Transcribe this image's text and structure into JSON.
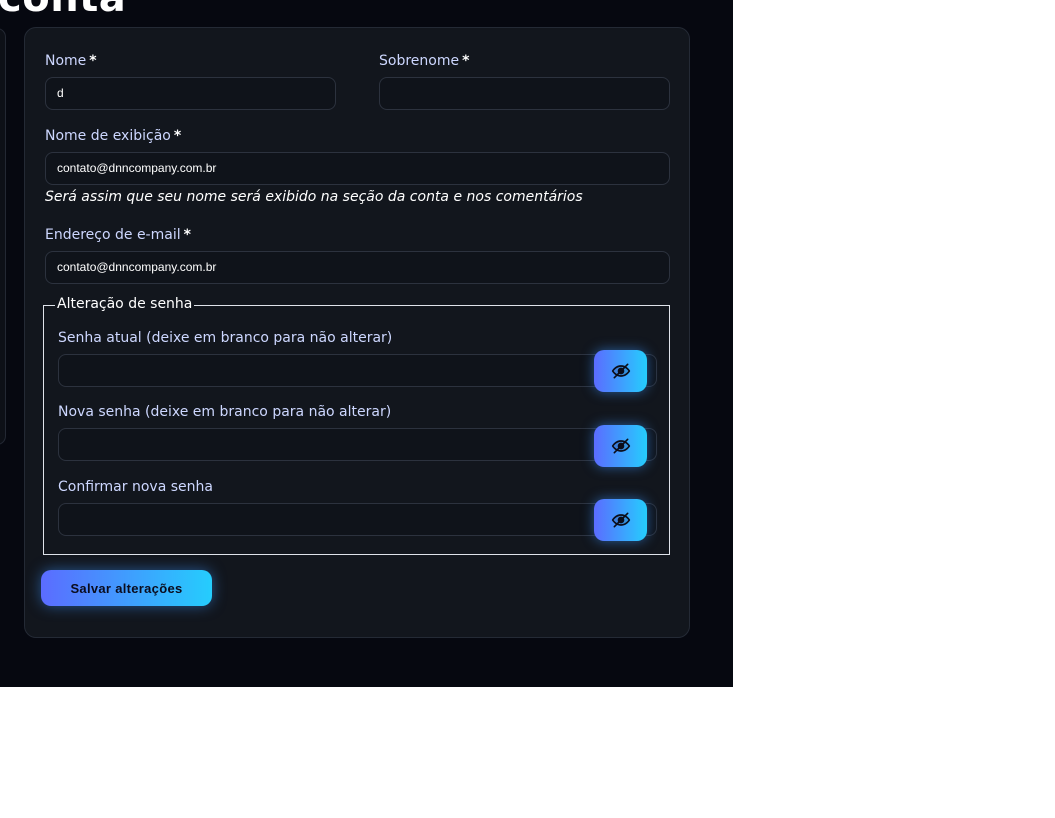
{
  "page": {
    "heading": "conta"
  },
  "form": {
    "first_name": {
      "label": "Nome",
      "required_mark": "*",
      "value": "d"
    },
    "last_name": {
      "label": "Sobrenome",
      "required_mark": "*",
      "value": ""
    },
    "display_name": {
      "label": "Nome de exibição",
      "required_mark": "*",
      "value": "contato@dnncompany.com.br",
      "help": "Será assim que seu nome será exibido na seção da conta e nos comentários"
    },
    "email": {
      "label": "Endereço de e-mail",
      "required_mark": "*",
      "value": "contato@dnncompany.com.br"
    },
    "password_change": {
      "legend": "Alteração de senha",
      "current": {
        "label": "Senha atual (deixe em branco para não alterar)",
        "value": ""
      },
      "new": {
        "label": "Nova senha (deixe em branco para não alterar)",
        "value": ""
      },
      "confirm": {
        "label": "Confirmar nova senha",
        "value": ""
      },
      "toggle_icon": "eye-slash-icon"
    },
    "save_label": "Salvar alterações"
  },
  "colors": {
    "page_bg": "#060810",
    "card_bg": "#12161d",
    "label": "#cdd7ff",
    "accent_start": "#5b6cff",
    "accent_end": "#25cdfd"
  }
}
